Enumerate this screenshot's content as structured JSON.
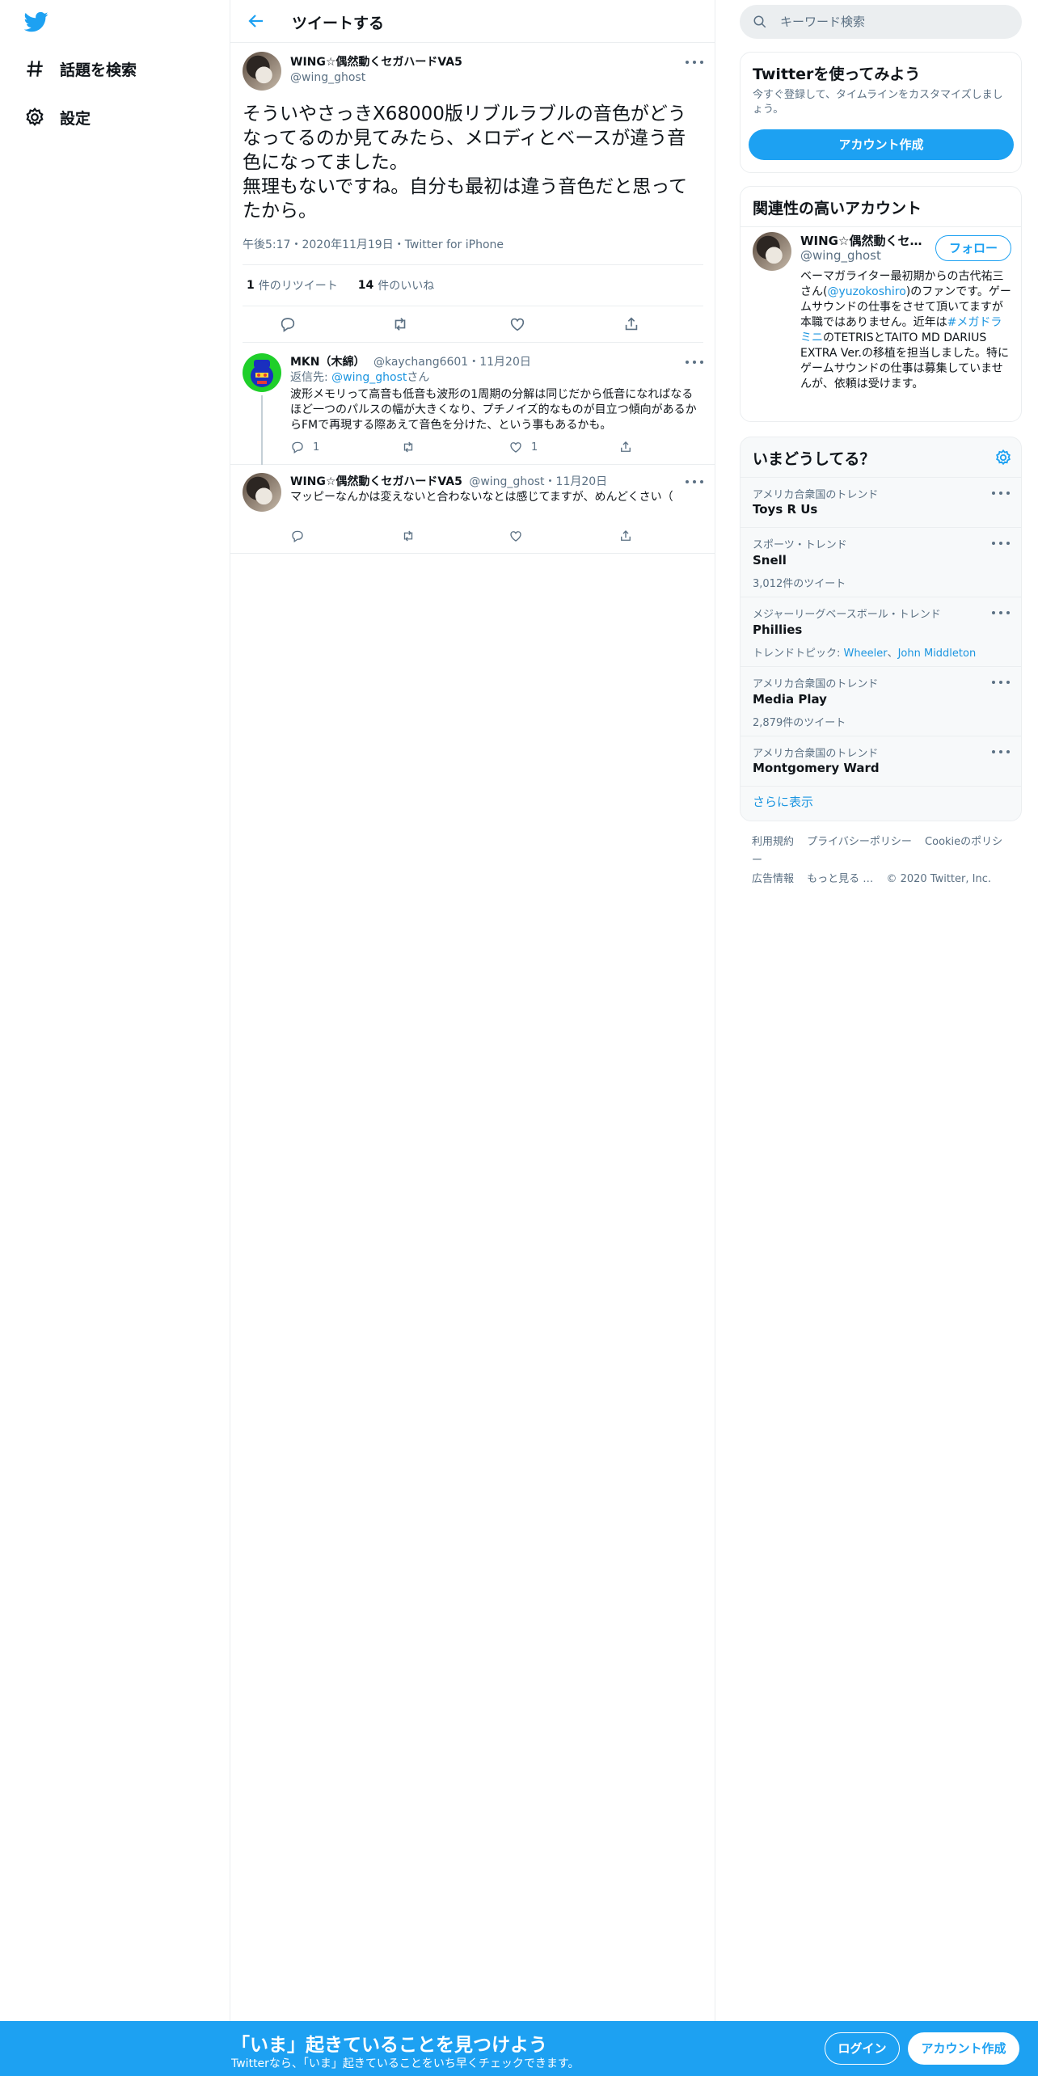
{
  "nav": {
    "explore_label": "話題を検索",
    "settings_label": "設定"
  },
  "main": {
    "header_title": "ツイートする",
    "focus_tweet": {
      "name": "WING☆偶然動くセガハードVA5",
      "handle": "@wing_ghost",
      "text": "そういやさっきX68000版リブルラブルの音色がどうなってるのか見てみたら、メロディとベースが違う音色になってました。\n無理もないですね。自分も最初は違う音色だと思ってたから。",
      "meta": "午後5:17・2020年11月19日・Twitter for iPhone",
      "retweet_count": "1",
      "retweet_label": "件のリツイート",
      "like_count": "14",
      "like_label": "件のいいね"
    },
    "replies": [
      {
        "name": "MKN（木綿）",
        "handle": "@kaychang6601",
        "date": "・11月20日",
        "reply_prefix": "返信先: ",
        "reply_to": "@wing_ghost",
        "reply_suffix": "さん",
        "text": "波形メモリって高音も低音も波形の1周期の分解は同じだから低音になればなるほど一つのパルスの幅が大きくなり、プチノイズ的なものが目立つ傾向があるからFMで再現する際あえて音色を分けた、という事もあるかも。",
        "reply_count": "1",
        "like_count": "1"
      },
      {
        "name": "WING☆偶然動くセガハードVA5",
        "handle": "@wing_ghost",
        "date": "・11月20日",
        "text": "マッピーなんかは変えないと合わないなとは感じてますが、めんどくさい（",
        "reply_count": "",
        "like_count": ""
      }
    ]
  },
  "right": {
    "search_placeholder": "キーワード検索",
    "signup_card": {
      "title": "Twitterを使ってみよう",
      "subtitle": "今すぐ登録して、タイムラインをカスタマイズしましょう。",
      "button": "アカウント作成"
    },
    "related": {
      "title": "関連性の高いアカウント",
      "name": "WING☆偶然動くセガハードVA5",
      "handle": "@wing_ghost",
      "follow": "フォロー",
      "bio_1": "ベーマガライター最初期からの古代祐三さん(",
      "bio_mention": "@yuzokoshiro",
      "bio_2": ")のファンです。ゲームサウンドの仕事をさせて頂いてますが本職ではありません。近年は",
      "bio_hashtag": "#メガドラミニ",
      "bio_3": "のTETRISとTAITO MD DARIUS EXTRA Ver.の移植を担当しました。特にゲームサウンドの仕事は募集していませんが、依頼は受けます。"
    },
    "trends": {
      "title": "いまどうしてる？",
      "items": [
        {
          "context": "アメリカ合衆国のトレンド",
          "name": "Toys R Us",
          "count": ""
        },
        {
          "context": "スポーツ・トレンド",
          "name": "Snell",
          "count": "3,012件のツイート"
        },
        {
          "context": "メジャーリーグベースボール・トレンド",
          "name": "Phillies",
          "topic_prefix": "トレンドトピック: ",
          "topic_1": "Wheeler",
          "topic_sep": "、",
          "topic_2": "John Middleton"
        },
        {
          "context": "アメリカ合衆国のトレンド",
          "name": "Media Play",
          "count": "2,879件のツイート"
        },
        {
          "context": "アメリカ合衆国のトレンド",
          "name": "Montgomery Ward",
          "count": ""
        }
      ],
      "show_more": "さらに表示"
    },
    "footer": [
      "利用規約",
      "プライバシーポリシー",
      "Cookieのポリシー",
      "広告情報",
      "もっと見る …",
      "© 2020 Twitter, Inc."
    ]
  },
  "bottom_bar": {
    "title": "「いま」起きていることを見つけよう",
    "subtitle": "Twitterなら、「いま」起きていることをいち早くチェックできます。",
    "login": "ログイン",
    "signup": "アカウント作成"
  },
  "colors": {
    "brand": "#1da1f2",
    "link": "#1b95e0",
    "muted": "#5b7083",
    "border": "#ebeef0"
  }
}
